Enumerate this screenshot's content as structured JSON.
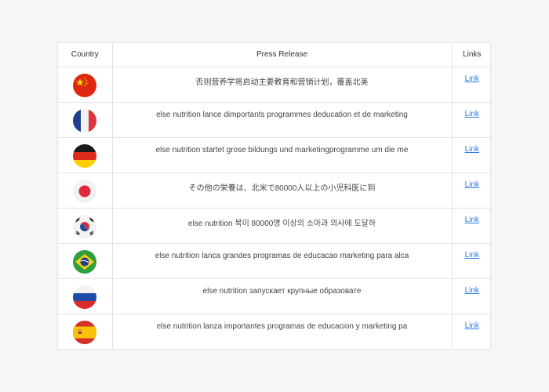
{
  "table": {
    "headers": {
      "country": "Country",
      "press": "Press Release",
      "links": "Links"
    },
    "rows": [
      {
        "flag": "china-flag-icon",
        "press": "否则营养学将启动主要教育和营销计划，覆盖北美",
        "link": "Link"
      },
      {
        "flag": "france-flag-icon",
        "press": "else nutrition lance dimportants programmes deducation et de marketing",
        "link": "Link"
      },
      {
        "flag": "germany-flag-icon",
        "press": "else nutrition startet grose bildungs und marketingprogramme um die me",
        "link": "Link"
      },
      {
        "flag": "japan-flag-icon",
        "press": "その他の栄養は、北米で80000人以上の小児科医に到",
        "link": "Link"
      },
      {
        "flag": "south-korea-flag-icon",
        "press": "else nutrition 북미 80000명 이상의 소아과 의사에 도달하",
        "link": "Link"
      },
      {
        "flag": "brazil-flag-icon",
        "press": "else nutrition lanca grandes programas de educacao marketing para alca",
        "link": "Link"
      },
      {
        "flag": "russia-flag-icon",
        "press": "else nutrition запускает крупные образовате",
        "link": "Link"
      },
      {
        "flag": "spain-flag-icon",
        "press": "else nutrition lanza importantes programas de educacion y marketing pa",
        "link": "Link"
      }
    ]
  },
  "colors": {
    "link": "#2a7de1",
    "border": "#e3e3e3"
  }
}
